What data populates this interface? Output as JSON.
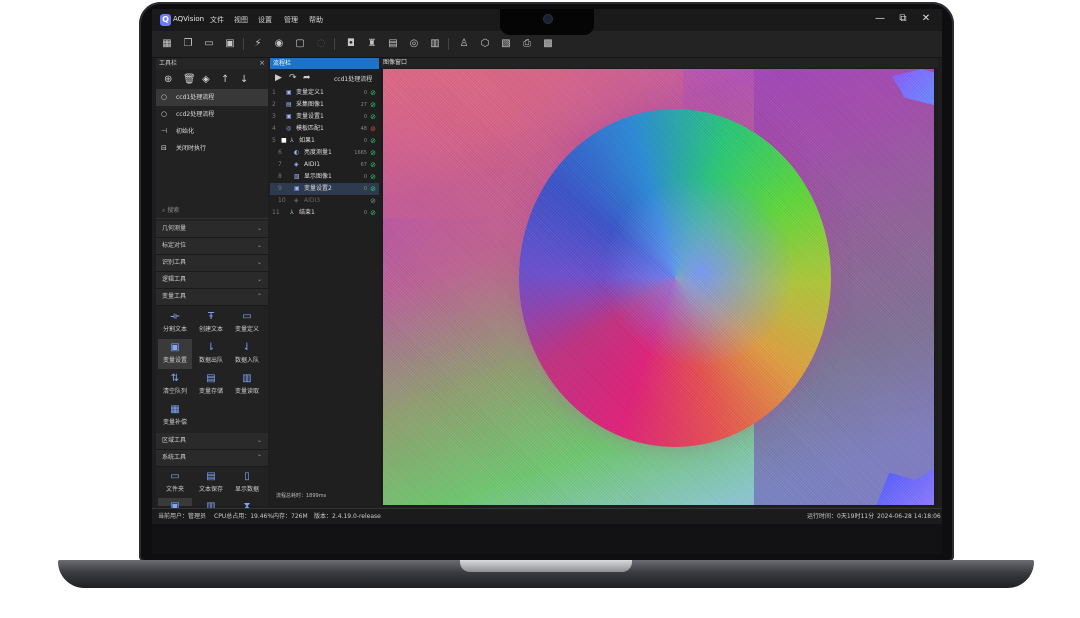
{
  "app": {
    "name": "AQVision",
    "logo_letter": "Q"
  },
  "menu": [
    "文件",
    "视图",
    "设置",
    "管理",
    "帮助"
  ],
  "window_controls": {
    "minimize": "—",
    "restore": "⧉",
    "close": "✕"
  },
  "toolbar_icons": [
    "grid-icon",
    "copy-icon",
    "folder-open-icon",
    "save-icon",
    "run-once-icon",
    "run-loop-icon",
    "stop-icon",
    "refresh-icon",
    "camera-icon",
    "tripod-icon",
    "board-icon",
    "circle-icon",
    "monitor-icon",
    "connection-icon",
    "cube-icon",
    "chart-icon",
    "printer-icon",
    "settings-panel-icon"
  ],
  "left_panel": {
    "title": "工具栏",
    "close": "×",
    "flows": [
      {
        "label": "ccd1处理流程",
        "active": true
      },
      {
        "label": "ccd2处理流程",
        "active": false
      },
      {
        "label": "初始化",
        "active": false
      },
      {
        "label": "关闭时执行",
        "active": false
      }
    ],
    "search_placeholder": "搜索",
    "categories": [
      {
        "label": "几何测量",
        "chevron": "⌄"
      },
      {
        "label": "标定对位",
        "chevron": "⌄"
      },
      {
        "label": "识别工具",
        "chevron": "⌄"
      },
      {
        "label": "逻辑工具",
        "chevron": "⌄"
      },
      {
        "label": "变量工具",
        "chevron": "⌃"
      },
      {
        "label": "区域工具",
        "chevron": "⌄"
      },
      {
        "label": "系统工具",
        "chevron": "⌃"
      }
    ],
    "variable_tools": [
      "分割文本",
      "创建文本",
      "变量定义",
      "变量设置",
      "数据出队",
      "数据入队",
      "清空队列",
      "变量存储",
      "变量读取",
      "变量补偿"
    ],
    "system_tools": [
      "文件夹",
      "文本保存",
      "显示数据"
    ]
  },
  "flow_panel": {
    "header": "流程栏",
    "title": "ccd1处理流程",
    "nodes": [
      {
        "num": "1",
        "label": "变量定义1",
        "time": "0",
        "status": "ok",
        "indent": 0
      },
      {
        "num": "2",
        "label": "采集图像1",
        "time": "27",
        "status": "ok",
        "indent": 0
      },
      {
        "num": "3",
        "label": "变量设置1",
        "time": "0",
        "status": "ok",
        "indent": 0
      },
      {
        "num": "4",
        "label": "模板匹配1",
        "time": "48",
        "status": "err",
        "indent": 0
      },
      {
        "num": "5",
        "label": "如果1",
        "time": "0",
        "status": "ok",
        "indent": 0
      },
      {
        "num": "6",
        "label": "亮度测量1",
        "time": "1665",
        "status": "ok",
        "indent": 1
      },
      {
        "num": "7",
        "label": "AIDI1",
        "time": "67",
        "status": "ok",
        "indent": 1
      },
      {
        "num": "8",
        "label": "显示图像1",
        "time": "0",
        "status": "ok",
        "indent": 1
      },
      {
        "num": "9",
        "label": "变量设置2",
        "time": "0",
        "status": "ok",
        "indent": 1
      },
      {
        "num": "10",
        "label": "AIDI3",
        "time": "",
        "status": "dis",
        "indent": 1
      },
      {
        "num": "11",
        "label": "结束1",
        "time": "0",
        "status": "ok",
        "indent": 0
      }
    ],
    "footer": "流程总耗时：1899ms"
  },
  "image_window": {
    "title": "图像窗口"
  },
  "status_bar": {
    "user": "当前用户：管理员",
    "cpu": "CPU总占用：19.46%",
    "memory": "内存：726M",
    "version": "版本：2.4.19.0-release",
    "runtime": "运行时间：0天19时11分",
    "datetime": "2024-06-28 14:18:06"
  },
  "colors": {
    "accent": "#1e73c8",
    "ok": "#2ecc71",
    "error": "#e74c3c",
    "chassis": "#0e0e10"
  }
}
